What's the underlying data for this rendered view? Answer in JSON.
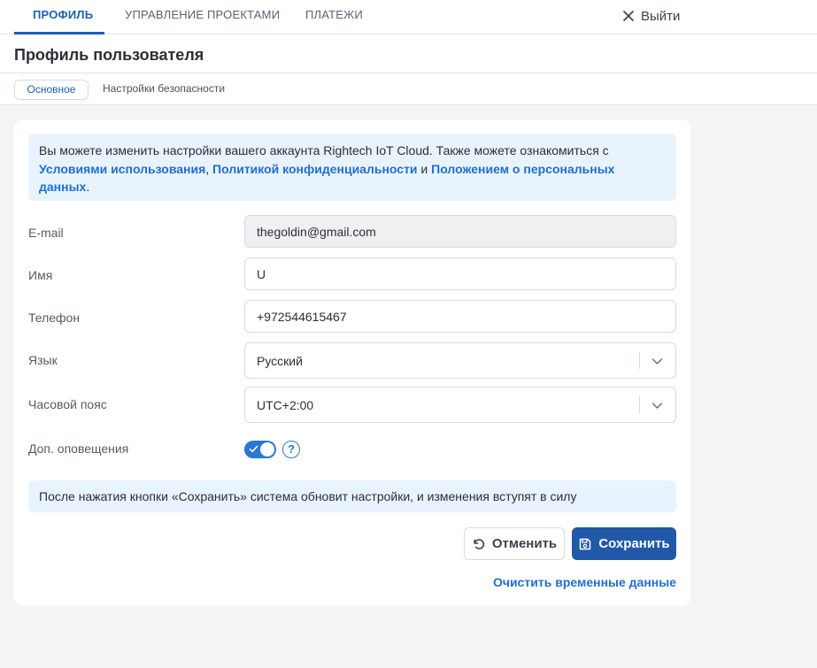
{
  "nav": {
    "tabs": [
      {
        "label": "Профиль",
        "active": true
      },
      {
        "label": "Управление проектами",
        "active": false
      },
      {
        "label": "Платежи",
        "active": false
      }
    ],
    "logout_label": "Выйти"
  },
  "page": {
    "title": "Профиль пользователя"
  },
  "subtabs": [
    {
      "label": "Основное",
      "active": true
    },
    {
      "label": "Настройки безопасности",
      "active": false
    }
  ],
  "info": {
    "text_1": "Вы можете изменить настройки вашего аккаунта Rightech IoT Cloud. Также можете ознакомиться с ",
    "link_terms": "Условиями использования",
    "sep_1": ", ",
    "link_privacy": "Политикой конфиденциальности",
    "sep_2": " и ",
    "link_personal": "Положением о персональных данных",
    "end": "."
  },
  "form": {
    "email_label": "E-mail",
    "email_value": "thegoldin@gmail.com",
    "name_label": "Имя",
    "name_value": "U",
    "phone_label": "Телефон",
    "phone_value": "+972544615467",
    "language_label": "Язык",
    "language_value": "Русский",
    "timezone_label": "Часовой пояс",
    "timezone_value": "UTC+2:00",
    "notifications_label": "Доп. оповещения",
    "notifications_enabled": true,
    "help_glyph": "?"
  },
  "note": {
    "text": "После нажатия кнопки «Сохранить» система обновит настройки, и изменения вступят в силу"
  },
  "actions": {
    "cancel_label": "Отменить",
    "save_label": "Сохранить",
    "clear_label": "Очистить временные данные"
  },
  "colors": {
    "accent": "#1e5fb3",
    "primary_button": "#2159a8",
    "link": "#1e6fd0",
    "info_bg": "#e9f3fe",
    "page_bg": "#f3f4f6"
  },
  "icons": {
    "logout": "close-icon",
    "select": "chevron-down-icon",
    "cancel": "undo-icon",
    "save": "save-icon",
    "toggle": "check-icon",
    "help": "help-icon"
  }
}
